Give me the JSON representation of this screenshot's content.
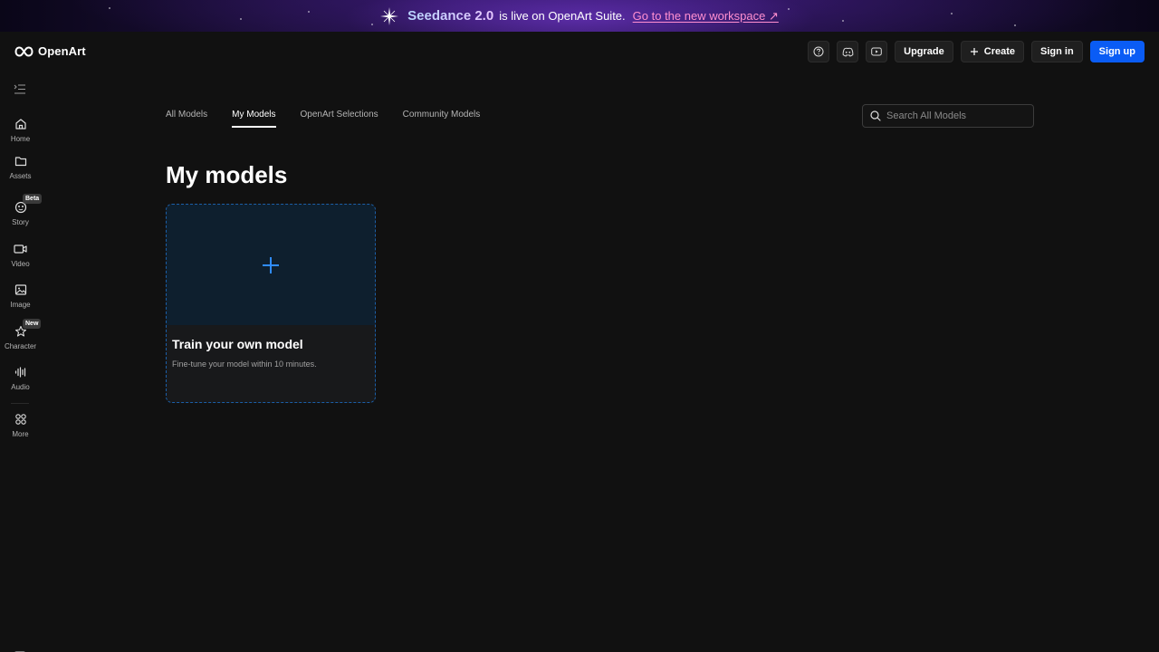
{
  "banner": {
    "brand": "Seedance 2.0",
    "text": "is live on OpenArt Suite.",
    "link": "Go to the new workspace ↗"
  },
  "header": {
    "logo": "OpenArt",
    "upgrade_label": "Upgrade",
    "create_label": "Create",
    "signin_label": "Sign in",
    "signup_label": "Sign up",
    "icons": [
      "help-icon",
      "discord-icon",
      "youtube-icon"
    ]
  },
  "sidebar": {
    "items": [
      {
        "label": "Home",
        "icon": "home-icon"
      },
      {
        "label": "Assets",
        "icon": "folder-icon"
      },
      {
        "label": "Story",
        "icon": "story-icon",
        "badge": "Beta"
      },
      {
        "label": "Video",
        "icon": "video-icon"
      },
      {
        "label": "Image",
        "icon": "image-icon"
      },
      {
        "label": "Character",
        "icon": "character-icon",
        "badge": "New"
      },
      {
        "label": "Audio",
        "icon": "audio-icon"
      },
      {
        "label": "More",
        "icon": "grid-icon"
      }
    ]
  },
  "main": {
    "tabs": [
      {
        "label": "All Models",
        "active": false
      },
      {
        "label": "My Models",
        "active": true
      },
      {
        "label": "OpenArt Selections",
        "active": false
      },
      {
        "label": "Community Models",
        "active": false
      }
    ],
    "search_placeholder": "Search All Models",
    "title": "My models",
    "card": {
      "title": "Train your own model",
      "description": "Fine-tune your model within 10 minutes."
    }
  },
  "colors": {
    "accent": "#0a5cf5",
    "background": "#111111",
    "card_border": "#1b5fa8",
    "plus": "#2f8cff",
    "link": "#ff8fd0"
  }
}
